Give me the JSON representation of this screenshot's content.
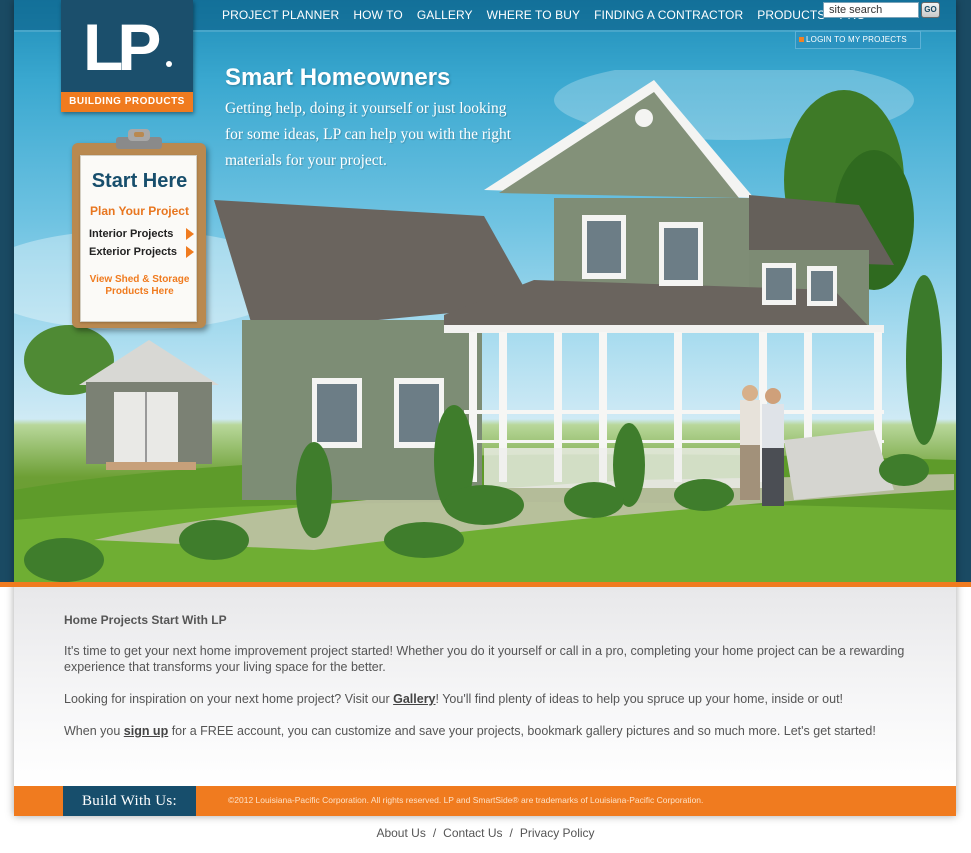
{
  "brand": {
    "logo_text": "LP",
    "logo_band": "BUILDING PRODUCTS",
    "build_with_us": "Build With Us:",
    "accent": "#f07b1f",
    "navy": "#174e6c"
  },
  "nav": {
    "items": [
      "PROJECT PLANNER",
      "HOW TO",
      "GALLERY",
      "WHERE TO BUY",
      "FINDING A CONTRACTOR",
      "PRODUCTS",
      "PRO"
    ]
  },
  "search": {
    "value": "site search",
    "go_label": "GO"
  },
  "login": {
    "label": "LOGIN TO MY PROJECTS"
  },
  "hero": {
    "title": "Smart Homeowners",
    "body": "Getting help, doing it yourself or just looking for some ideas, LP can help you with the right materials for your project."
  },
  "clipboard": {
    "title": "Start Here",
    "subtitle": "Plan Your Project",
    "links": [
      "Interior Projects",
      "Exterior Projects"
    ],
    "shed_line1": "View Shed & Storage",
    "shed_line2": "Products Here"
  },
  "content": {
    "heading": "Home Projects Start With LP",
    "p1": "It's time to get your next home improvement project started! Whether you do it yourself or call in a pro, completing your home project can be a rewarding experience that transforms your living space for the better.",
    "p2_before": "Looking for inspiration on your next home project? Visit our ",
    "p2_link": "Gallery",
    "p2_after": "! You'll find plenty of ideas to help you spruce up your home, inside or out!",
    "p3_before": "When you ",
    "p3_link": "sign up",
    "p3_after": " for a FREE account, you can customize and save your projects, bookmark gallery pictures and so much more. Let's get started!"
  },
  "footer": {
    "copyright": "©2012 Louisiana-Pacific Corporation. All rights reserved. LP and SmartSide® are trademarks of Louisiana-Pacific Corporation."
  },
  "bottom_links": [
    "About Us",
    "Contact Us",
    "Privacy Policy"
  ]
}
